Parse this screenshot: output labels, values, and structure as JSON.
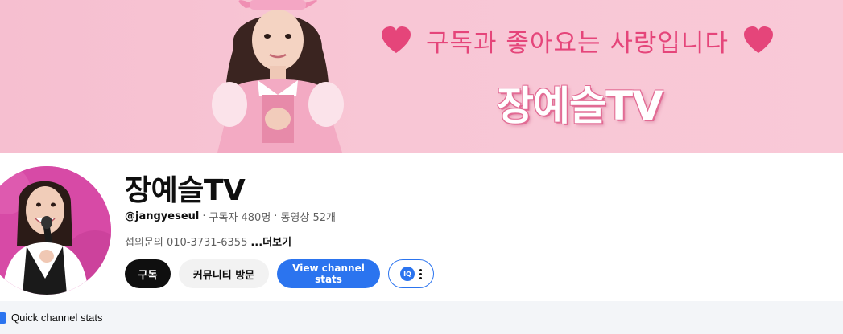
{
  "banner": {
    "tagline": "구독과 좋아요는 사랑입니다",
    "title": "장예슬TV"
  },
  "channel": {
    "name": "장예슬TV",
    "handle": "@jangyeseul",
    "separator": "·",
    "subscribers": "구독자 480명",
    "videos": "동영상 52개",
    "description": "섭외문의 010-3731-6355",
    "more_label": "...더보기"
  },
  "actions": {
    "subscribe_label": "구독",
    "community_label": "커뮤니티 방문",
    "stats_label": "View channel stats",
    "ext_logo_text": "IQ"
  },
  "quick_stats": {
    "label": "Quick channel stats"
  },
  "colors": {
    "banner_bg": "#f8c6d5",
    "accent_pink": "#e5457a",
    "stats_blue": "#2b74ef",
    "subscribe_bg": "#0f0f0f"
  },
  "icons": [
    "heart-icon",
    "kebab-menu-icon",
    "extension-logo-icon",
    "quick-stats-icon"
  ]
}
